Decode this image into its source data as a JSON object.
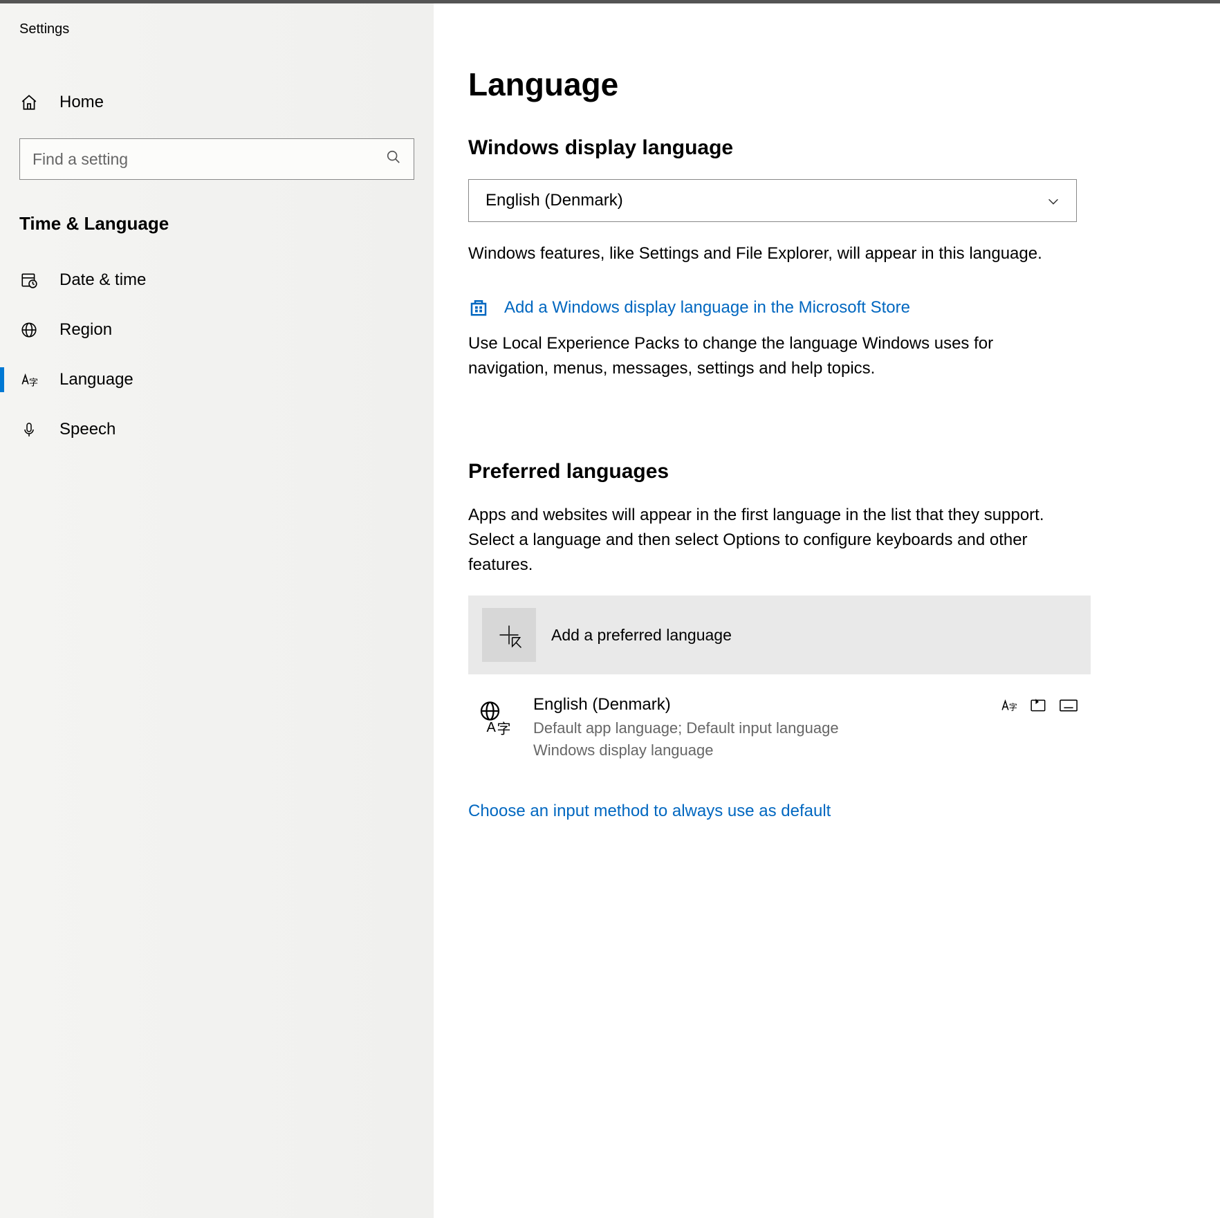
{
  "app_title": "Settings",
  "sidebar": {
    "home_label": "Home",
    "search_placeholder": "Find a setting",
    "section_title": "Time & Language",
    "items": [
      {
        "id": "date-time",
        "label": "Date & time"
      },
      {
        "id": "region",
        "label": "Region"
      },
      {
        "id": "language",
        "label": "Language"
      },
      {
        "id": "speech",
        "label": "Speech"
      }
    ],
    "active": "language"
  },
  "page": {
    "heading": "Language",
    "display_language": {
      "title": "Windows display language",
      "selected": "English (Denmark)",
      "description": "Windows features, like Settings and File Explorer, will appear in this language.",
      "store_link": "Add a Windows display language in the Microsoft Store",
      "store_description": "Use Local Experience Packs to change the language Windows uses for navigation, menus, messages, settings and help topics."
    },
    "preferred_languages": {
      "title": "Preferred languages",
      "description": "Apps and websites will appear in the first language in the list that they support. Select a language and then select Options to configure keyboards and other features.",
      "add_label": "Add a preferred language",
      "items": [
        {
          "name": "English (Denmark)",
          "subtitle": "Default app language; Default input language\nWindows display language"
        }
      ],
      "input_method_link": "Choose an input method to always use as default"
    }
  }
}
